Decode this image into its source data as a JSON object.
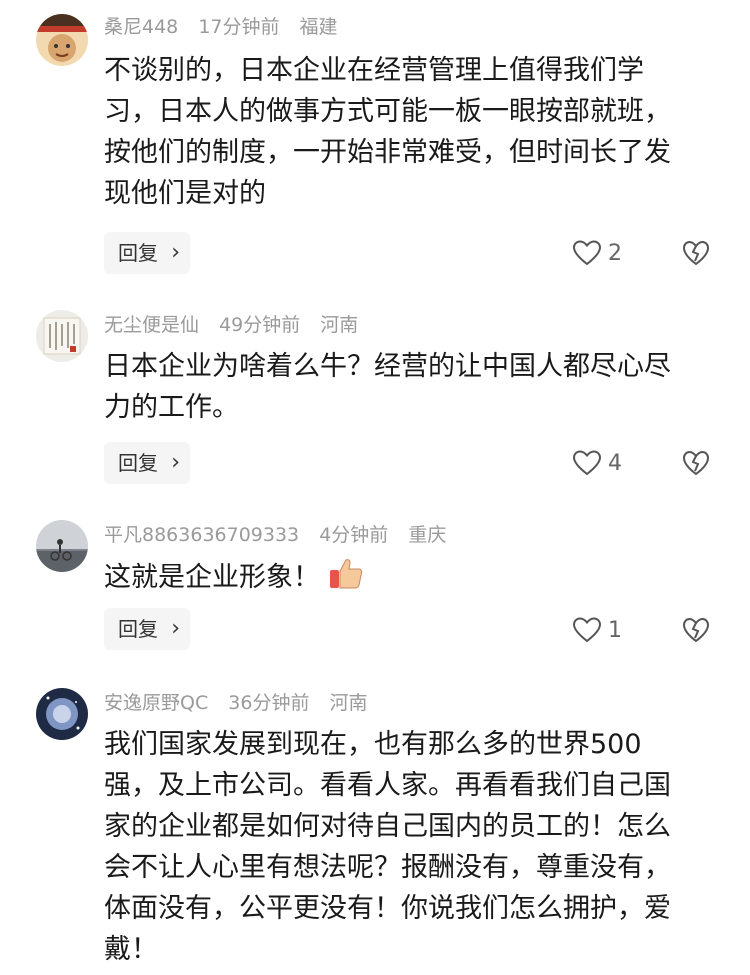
{
  "comments": [
    {
      "username": "桑尼448",
      "time": "17分钟前",
      "location": "福建",
      "lines": [
        "不谈别的，日本企业在经营管理上值得我们学",
        "习，日本人的做事方式可能一板一眼按部就班，",
        "按他们的制度，一开始非常难受，但时间长了发",
        "现他们是对的"
      ],
      "reply_label": "回复",
      "likes": "2"
    },
    {
      "username": "无尘便是仙",
      "time": "49分钟前",
      "location": "河南",
      "lines": [
        "日本企业为啥着么牛？经营的让中国人都尽心尽",
        "力的工作。"
      ],
      "reply_label": "回复",
      "likes": "4"
    },
    {
      "username": "平凡8863636709333",
      "time": "4分钟前",
      "location": "重庆",
      "lines": [
        "这就是企业形象！"
      ],
      "reply_label": "回复",
      "likes": "1"
    },
    {
      "username": "安逸原野QC",
      "time": "36分钟前",
      "location": "河南",
      "lines": [
        "我们国家发展到现在，也有那么多的世界500",
        "强，及上市公司。看看人家。再看看我们自己国",
        "家的企业都是如何对待自己国内的员工的！怎么",
        "会不让人心里有想法呢？报酬没有，尊重没有，",
        "体面没有，公平更没有！你说我们怎么拥护，爱",
        "戴！"
      ]
    }
  ]
}
